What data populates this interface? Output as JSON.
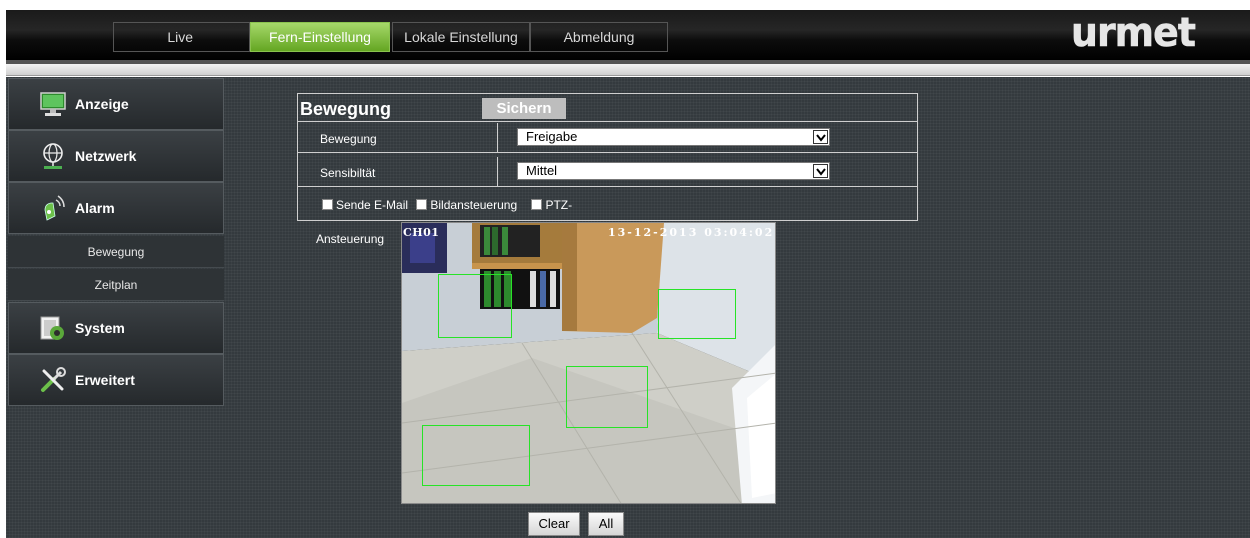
{
  "nav": {
    "tabs": [
      {
        "label": "Live"
      },
      {
        "label": "Fern-Einstellung"
      },
      {
        "label": "Lokale Einstellung"
      },
      {
        "label": "Abmeldung"
      }
    ],
    "active_color": "#7cbf3a",
    "brand": "urmet"
  },
  "sidebar": {
    "items": [
      {
        "label": "Anzeige",
        "icon": "monitor-icon"
      },
      {
        "label": "Netzwerk",
        "icon": "network-icon"
      },
      {
        "label": "Alarm",
        "icon": "alarm-icon"
      },
      {
        "label": "System",
        "icon": "system-icon"
      },
      {
        "label": "Erweitert",
        "icon": "tools-icon"
      }
    ],
    "alarm_subitems": [
      {
        "label": "Bewegung"
      },
      {
        "label": "Zeitplan"
      }
    ]
  },
  "form": {
    "title": "Bewegung",
    "save_label": "Sichern",
    "motion_label": "Bewegung",
    "motion_value": "Freigabe",
    "sensitivity_label": "Sensibiltät",
    "sensitivity_value": "Mittel",
    "checks": {
      "email": "Sende E-Mail",
      "image": "Bildansteuerung",
      "ptz": "PTZ-"
    },
    "area_label": "Ansteuerung"
  },
  "camera": {
    "channel": "CH01",
    "timestamp": "13-12-2013 03:04:02",
    "zone_color": "#27e327"
  },
  "buttons": {
    "clear": "Clear",
    "all": "All"
  }
}
